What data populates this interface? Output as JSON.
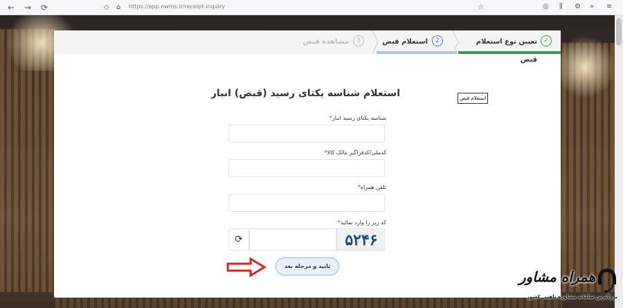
{
  "browser": {
    "url": "https://app.nwms.ir/receipt-inquiry"
  },
  "stepper": {
    "steps": [
      {
        "label": "تعیین نوع استعلام قبض",
        "state": "done",
        "marker": "✓"
      },
      {
        "label": "استعلام قبض",
        "state": "active",
        "marker": "2"
      },
      {
        "label": "مشاهده قبض",
        "state": "pending",
        "marker": "3"
      }
    ]
  },
  "form": {
    "title": "استعلام شناسه یکتای رسید (قبض) انبار",
    "side_button": "استعلام قبض",
    "fields": [
      {
        "label": "شناسه یکتای رسید انبار",
        "value": ""
      },
      {
        "label": "کدملی/کدفراگیر مالک کالا",
        "value": ""
      },
      {
        "label": "تلفن همراه",
        "value": ""
      }
    ],
    "captcha_label": "کد زیر را وارد نمائید",
    "captcha_text": "۵۲۴۶",
    "refresh_icon": "⟳",
    "submit_label": "تایید و مرحله بعد"
  },
  "watermark": {
    "title": "همراه مشاور",
    "subtitle": "بزرگترین سامانه مشاوره تلفنی کشور"
  },
  "colors": {
    "done": "#2aa24a",
    "active": "#4a7fc0",
    "arrow": "#e01f1f",
    "required": "#d22222"
  }
}
